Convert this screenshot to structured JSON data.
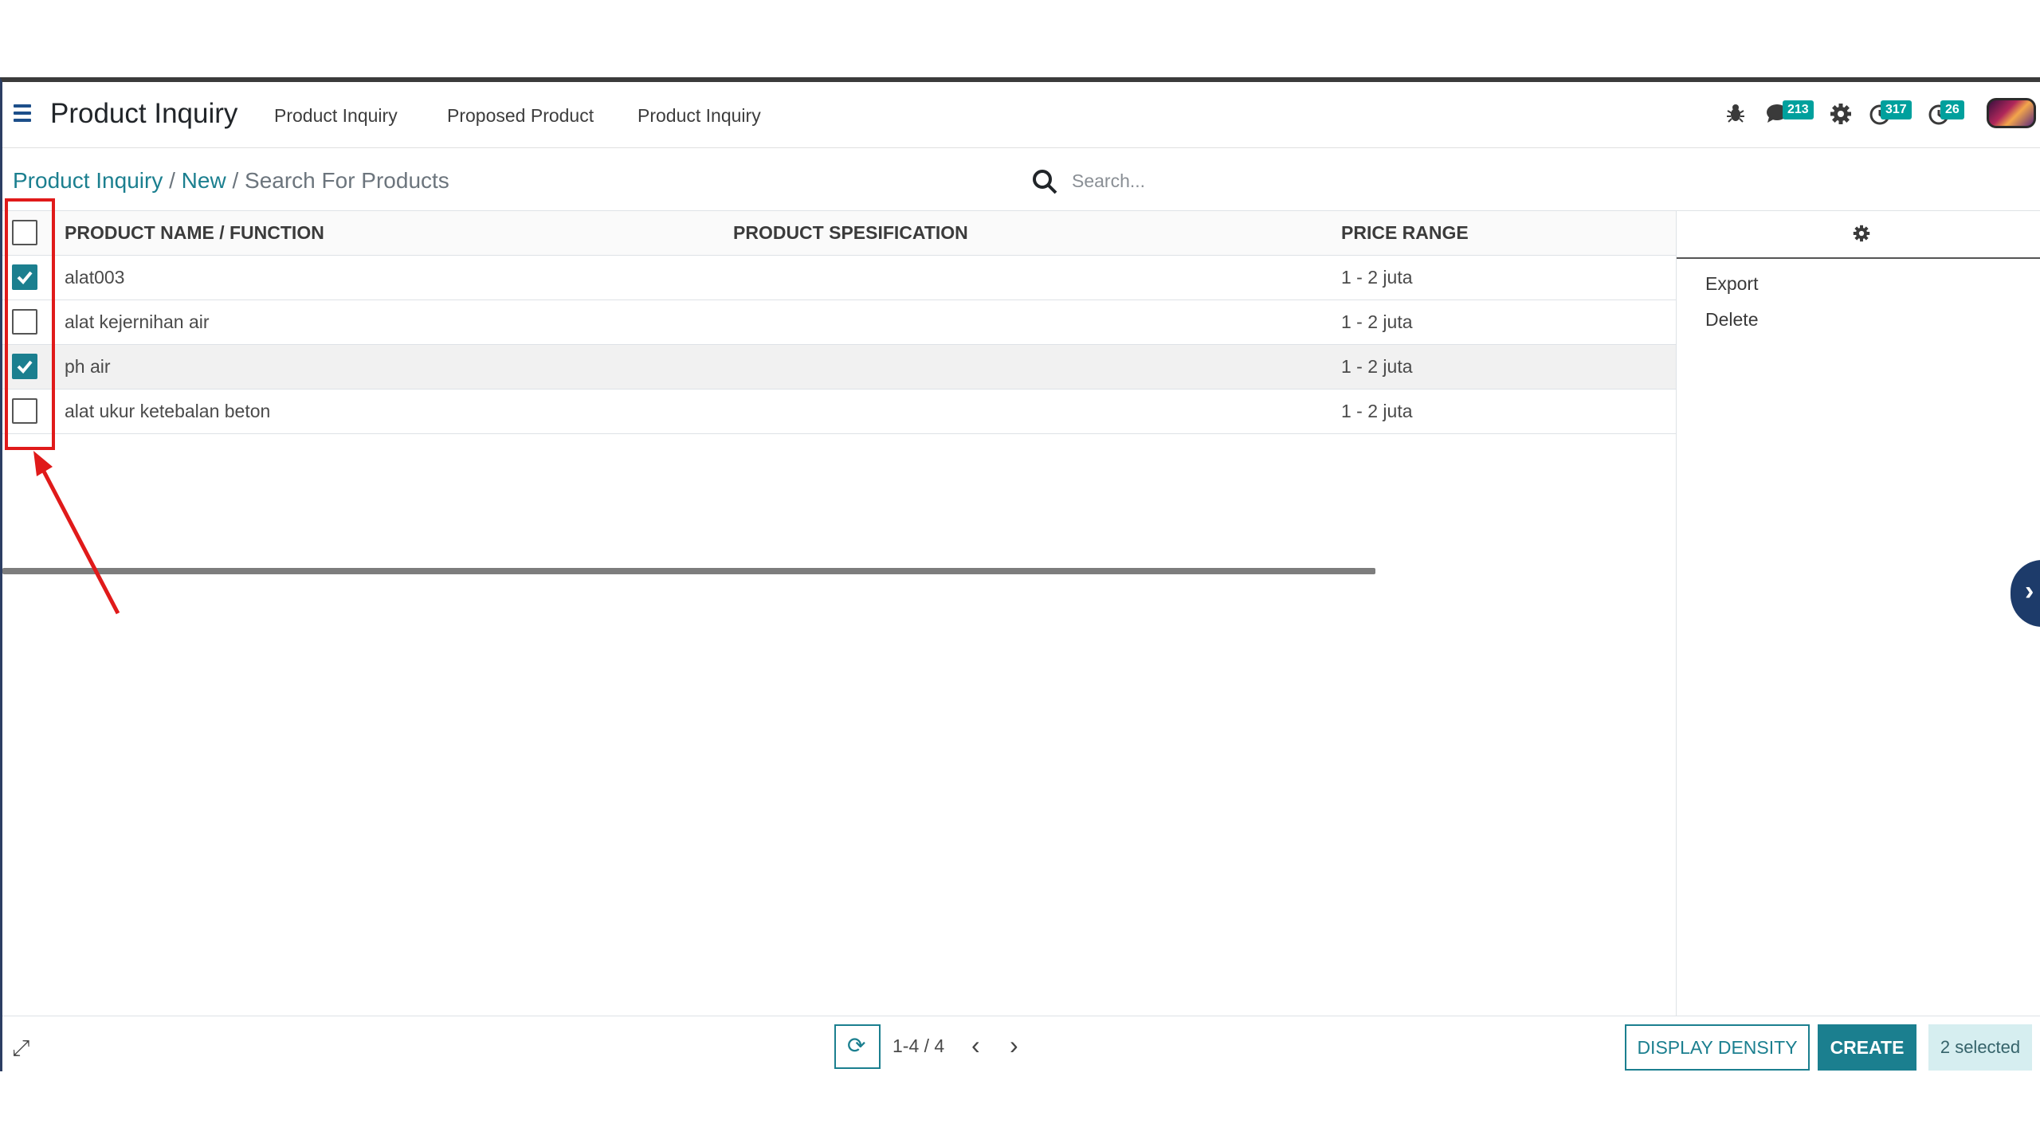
{
  "navbar": {
    "app_title": "Product Inquiry",
    "menu": [
      "Product Inquiry",
      "Proposed Product",
      "Product Inquiry"
    ],
    "badges": {
      "messages": "213",
      "activities": "317",
      "clock": "26"
    },
    "accent_color": "#1b7f8f"
  },
  "breadcrumb": {
    "crumbs": [
      "Product Inquiry",
      "New"
    ],
    "separator": "/",
    "current": "Search For Products"
  },
  "search": {
    "placeholder": "Search..."
  },
  "table": {
    "columns": [
      "PRODUCT NAME / FUNCTION",
      "PRODUCT SPESIFICATION",
      "PRICE RANGE"
    ],
    "rows": [
      {
        "name": "alat003",
        "spec": "",
        "price": "1 - 2 juta",
        "checked": true
      },
      {
        "name": "alat kejernihan air",
        "spec": "",
        "price": "1 - 2 juta",
        "checked": false
      },
      {
        "name": "ph air",
        "spec": "",
        "price": "1 - 2 juta",
        "checked": true
      },
      {
        "name": "alat ukur ketebalan beton",
        "spec": "",
        "price": "1 - 2 juta",
        "checked": false
      }
    ]
  },
  "side_panel": {
    "actions": [
      "Export",
      "Delete"
    ]
  },
  "footer": {
    "pager_value": "1-4 / 4",
    "display_density": "DISPLAY DENSITY",
    "create": "CREATE",
    "selected": "2 selected"
  }
}
